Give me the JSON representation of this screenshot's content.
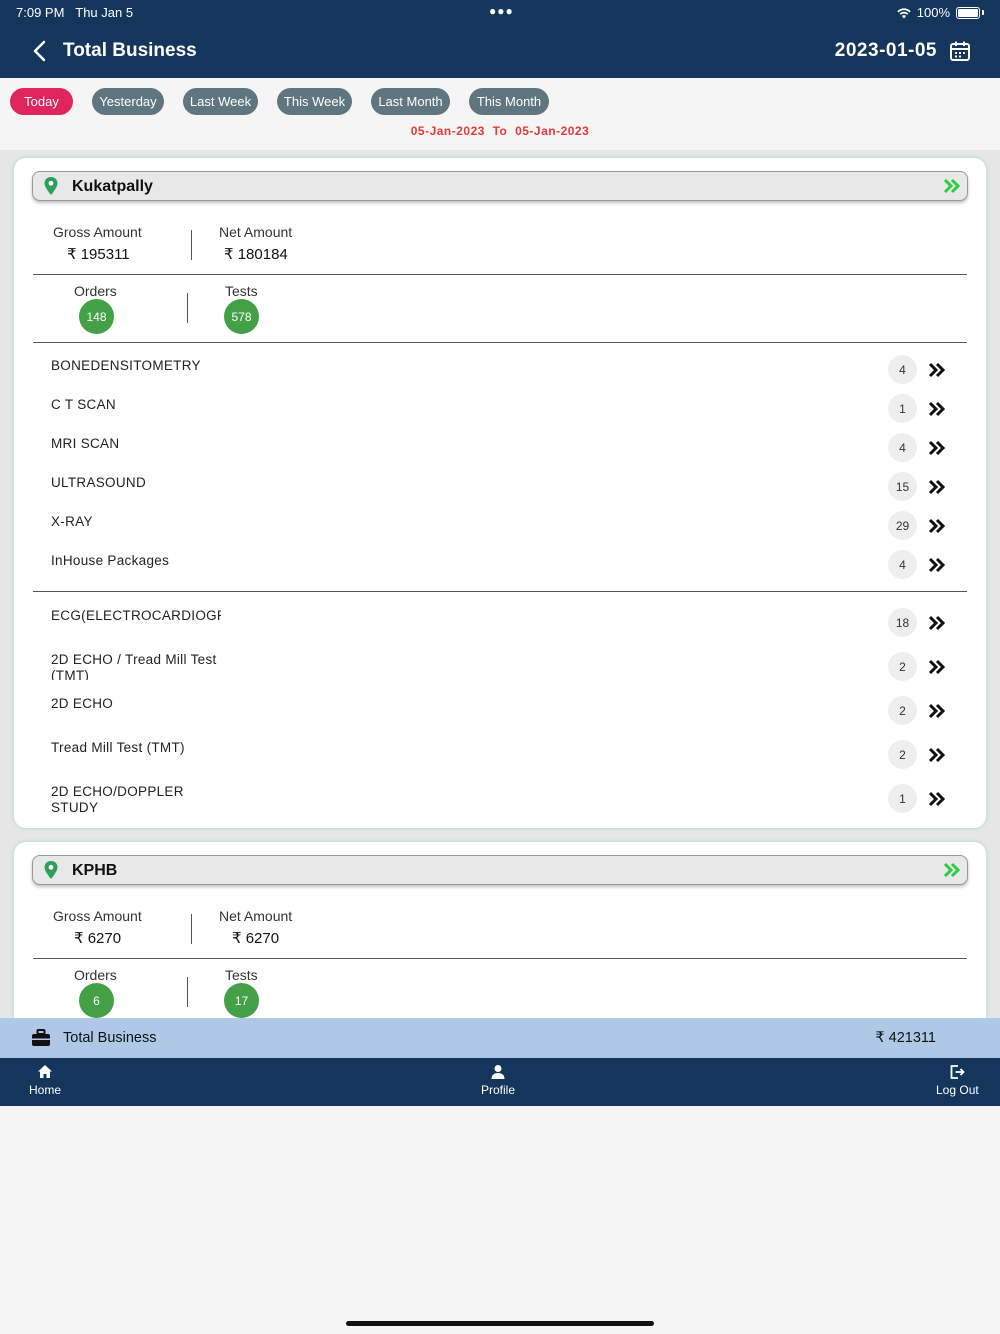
{
  "status_bar": {
    "time": "7:09 PM",
    "date": "Thu Jan 5",
    "battery": "100%"
  },
  "header": {
    "title": "Total Business",
    "date": "2023-01-05"
  },
  "filters": {
    "chips": [
      "Today",
      "Yesterday",
      "Last Week",
      "This Week",
      "Last Month",
      "This Month"
    ],
    "active": "Today",
    "range_from": "05-Jan-2023",
    "range_to_word": "To",
    "range_to": "05-Jan-2023"
  },
  "branches": [
    {
      "name": "Kukatpally",
      "gross_label": "Gross Amount",
      "gross_value": "₹ 195311",
      "net_label": "Net Amount",
      "net_value": "₹ 180184",
      "orders_label": "Orders",
      "orders_value": "148",
      "tests_label": "Tests",
      "tests_value": "578",
      "groups": [
        [
          {
            "name": "BONEDENSITOMETRY",
            "count": "4"
          },
          {
            "name": "C T SCAN",
            "count": "1"
          },
          {
            "name": "MRI SCAN",
            "count": "4"
          },
          {
            "name": "ULTRASOUND",
            "count": "15"
          },
          {
            "name": "X-RAY",
            "count": "29"
          },
          {
            "name": "InHouse Packages",
            "count": "4"
          }
        ],
        [
          {
            "name": "ECG(ELECTROCARDIOGRAM)",
            "count": "18"
          },
          {
            "name": "2D ECHO / Tread Mill Test (TMT)",
            "count": "2"
          },
          {
            "name": "2D ECHO",
            "count": "2"
          },
          {
            "name": "Tread Mill Test (TMT)",
            "count": "2"
          },
          {
            "name": "2D ECHO/DOPPLER STUDY",
            "count": "1"
          }
        ]
      ]
    },
    {
      "name": "KPHB",
      "gross_label": "Gross Amount",
      "gross_value": "₹ 6270",
      "net_label": "Net Amount",
      "net_value": "₹ 6270",
      "orders_label": "Orders",
      "orders_value": "6",
      "tests_label": "Tests",
      "tests_value": "17",
      "groups": []
    }
  ],
  "total_bar": {
    "label": "Total Business",
    "value": "₹ 421311"
  },
  "nav": {
    "home": "Home",
    "profile": "Profile",
    "logout": "Log Out"
  },
  "colors": {
    "header": "#14365c",
    "active_chip": "#e0245e",
    "chip": "#5f7580",
    "badge_green": "#43a047",
    "range_red": "#e53935",
    "total_bar": "#aec8e5"
  }
}
